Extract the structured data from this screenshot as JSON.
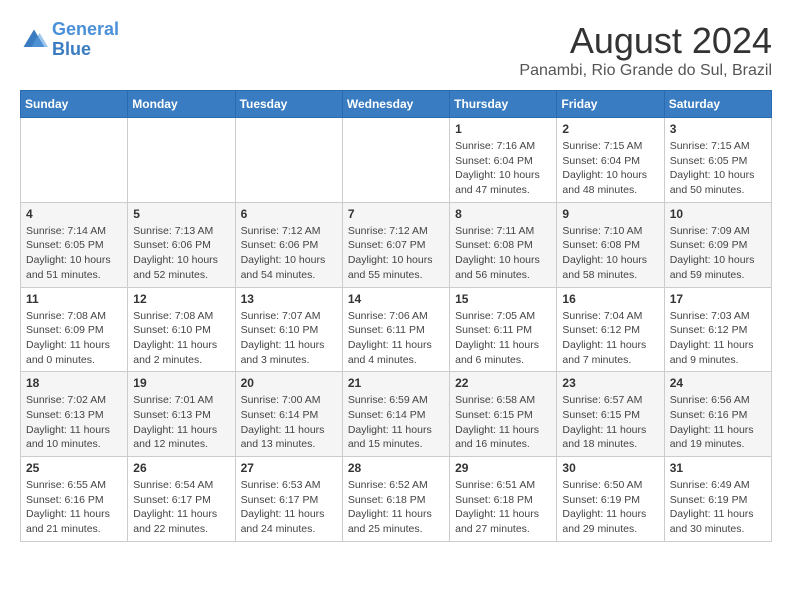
{
  "header": {
    "logo_line1": "General",
    "logo_line2": "Blue",
    "title": "August 2024",
    "subtitle": "Panambi, Rio Grande do Sul, Brazil"
  },
  "columns": [
    "Sunday",
    "Monday",
    "Tuesday",
    "Wednesday",
    "Thursday",
    "Friday",
    "Saturday"
  ],
  "weeks": [
    [
      {
        "day": "",
        "info": ""
      },
      {
        "day": "",
        "info": ""
      },
      {
        "day": "",
        "info": ""
      },
      {
        "day": "",
        "info": ""
      },
      {
        "day": "1",
        "info": "Sunrise: 7:16 AM\nSunset: 6:04 PM\nDaylight: 10 hours\nand 47 minutes."
      },
      {
        "day": "2",
        "info": "Sunrise: 7:15 AM\nSunset: 6:04 PM\nDaylight: 10 hours\nand 48 minutes."
      },
      {
        "day": "3",
        "info": "Sunrise: 7:15 AM\nSunset: 6:05 PM\nDaylight: 10 hours\nand 50 minutes."
      }
    ],
    [
      {
        "day": "4",
        "info": "Sunrise: 7:14 AM\nSunset: 6:05 PM\nDaylight: 10 hours\nand 51 minutes."
      },
      {
        "day": "5",
        "info": "Sunrise: 7:13 AM\nSunset: 6:06 PM\nDaylight: 10 hours\nand 52 minutes."
      },
      {
        "day": "6",
        "info": "Sunrise: 7:12 AM\nSunset: 6:06 PM\nDaylight: 10 hours\nand 54 minutes."
      },
      {
        "day": "7",
        "info": "Sunrise: 7:12 AM\nSunset: 6:07 PM\nDaylight: 10 hours\nand 55 minutes."
      },
      {
        "day": "8",
        "info": "Sunrise: 7:11 AM\nSunset: 6:08 PM\nDaylight: 10 hours\nand 56 minutes."
      },
      {
        "day": "9",
        "info": "Sunrise: 7:10 AM\nSunset: 6:08 PM\nDaylight: 10 hours\nand 58 minutes."
      },
      {
        "day": "10",
        "info": "Sunrise: 7:09 AM\nSunset: 6:09 PM\nDaylight: 10 hours\nand 59 minutes."
      }
    ],
    [
      {
        "day": "11",
        "info": "Sunrise: 7:08 AM\nSunset: 6:09 PM\nDaylight: 11 hours\nand 0 minutes."
      },
      {
        "day": "12",
        "info": "Sunrise: 7:08 AM\nSunset: 6:10 PM\nDaylight: 11 hours\nand 2 minutes."
      },
      {
        "day": "13",
        "info": "Sunrise: 7:07 AM\nSunset: 6:10 PM\nDaylight: 11 hours\nand 3 minutes."
      },
      {
        "day": "14",
        "info": "Sunrise: 7:06 AM\nSunset: 6:11 PM\nDaylight: 11 hours\nand 4 minutes."
      },
      {
        "day": "15",
        "info": "Sunrise: 7:05 AM\nSunset: 6:11 PM\nDaylight: 11 hours\nand 6 minutes."
      },
      {
        "day": "16",
        "info": "Sunrise: 7:04 AM\nSunset: 6:12 PM\nDaylight: 11 hours\nand 7 minutes."
      },
      {
        "day": "17",
        "info": "Sunrise: 7:03 AM\nSunset: 6:12 PM\nDaylight: 11 hours\nand 9 minutes."
      }
    ],
    [
      {
        "day": "18",
        "info": "Sunrise: 7:02 AM\nSunset: 6:13 PM\nDaylight: 11 hours\nand 10 minutes."
      },
      {
        "day": "19",
        "info": "Sunrise: 7:01 AM\nSunset: 6:13 PM\nDaylight: 11 hours\nand 12 minutes."
      },
      {
        "day": "20",
        "info": "Sunrise: 7:00 AM\nSunset: 6:14 PM\nDaylight: 11 hours\nand 13 minutes."
      },
      {
        "day": "21",
        "info": "Sunrise: 6:59 AM\nSunset: 6:14 PM\nDaylight: 11 hours\nand 15 minutes."
      },
      {
        "day": "22",
        "info": "Sunrise: 6:58 AM\nSunset: 6:15 PM\nDaylight: 11 hours\nand 16 minutes."
      },
      {
        "day": "23",
        "info": "Sunrise: 6:57 AM\nSunset: 6:15 PM\nDaylight: 11 hours\nand 18 minutes."
      },
      {
        "day": "24",
        "info": "Sunrise: 6:56 AM\nSunset: 6:16 PM\nDaylight: 11 hours\nand 19 minutes."
      }
    ],
    [
      {
        "day": "25",
        "info": "Sunrise: 6:55 AM\nSunset: 6:16 PM\nDaylight: 11 hours\nand 21 minutes."
      },
      {
        "day": "26",
        "info": "Sunrise: 6:54 AM\nSunset: 6:17 PM\nDaylight: 11 hours\nand 22 minutes."
      },
      {
        "day": "27",
        "info": "Sunrise: 6:53 AM\nSunset: 6:17 PM\nDaylight: 11 hours\nand 24 minutes."
      },
      {
        "day": "28",
        "info": "Sunrise: 6:52 AM\nSunset: 6:18 PM\nDaylight: 11 hours\nand 25 minutes."
      },
      {
        "day": "29",
        "info": "Sunrise: 6:51 AM\nSunset: 6:18 PM\nDaylight: 11 hours\nand 27 minutes."
      },
      {
        "day": "30",
        "info": "Sunrise: 6:50 AM\nSunset: 6:19 PM\nDaylight: 11 hours\nand 29 minutes."
      },
      {
        "day": "31",
        "info": "Sunrise: 6:49 AM\nSunset: 6:19 PM\nDaylight: 11 hours\nand 30 minutes."
      }
    ]
  ]
}
